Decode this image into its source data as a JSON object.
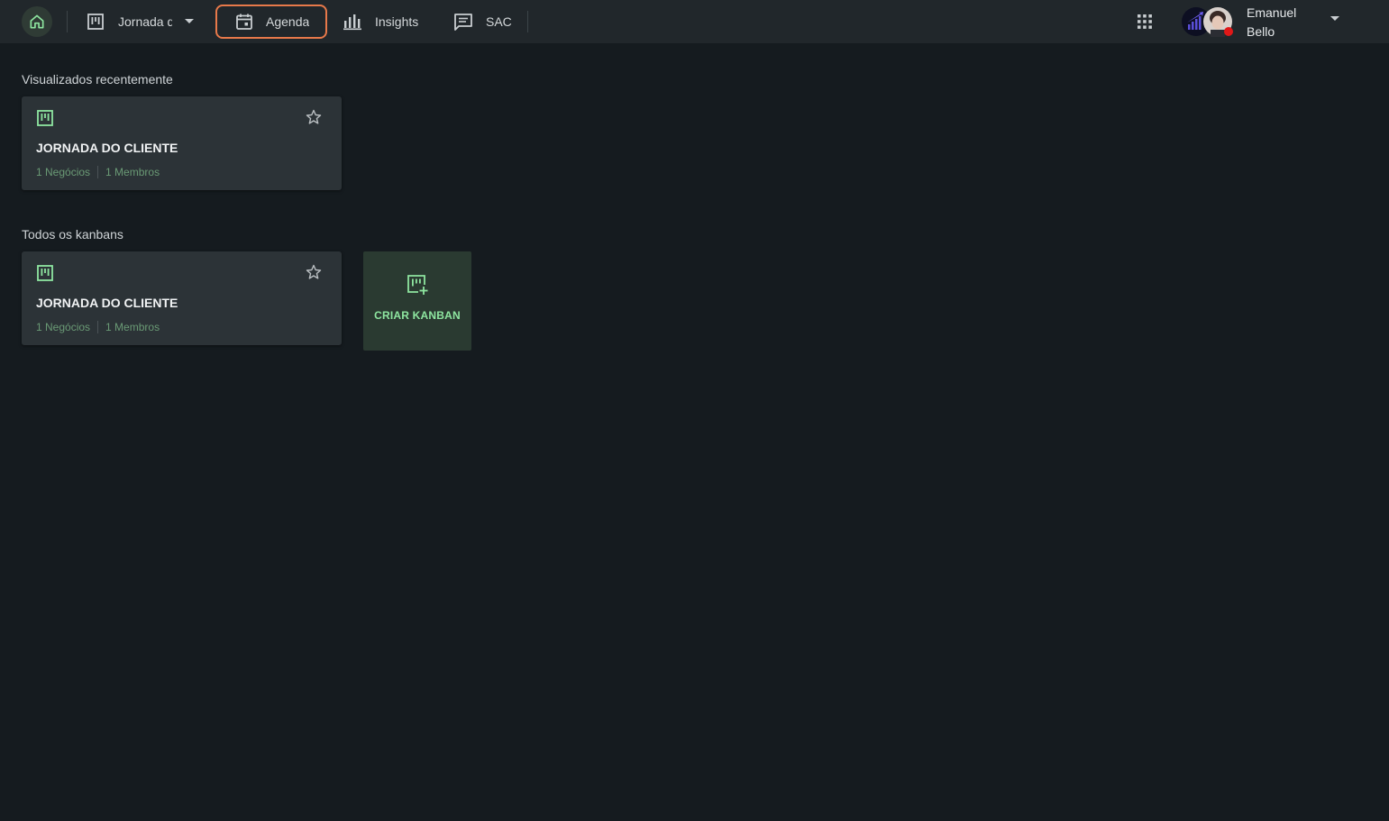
{
  "nav": {
    "board_label": "Jornada do Cliente",
    "agenda_label": "Agenda",
    "insights_label": "Insights",
    "sac_label": "SAC"
  },
  "user": {
    "first_name": "Emanuel",
    "last_name": "Bello"
  },
  "recent": {
    "title": "Visualizados recentemente",
    "cards": [
      {
        "title": "JORNADA DO CLIENTE",
        "deals": "1 Negócios",
        "members": "1 Membros"
      }
    ]
  },
  "all": {
    "title": "Todos os kanbans",
    "cards": [
      {
        "title": "JORNADA DO CLIENTE",
        "deals": "1 Negócios",
        "members": "1 Membros"
      }
    ],
    "create_label": "CRIAR KANBAN"
  },
  "colors": {
    "accent": "#8ee6a0",
    "highlight": "#e8794a",
    "background": "#151b1f",
    "topbar": "#21272b"
  }
}
